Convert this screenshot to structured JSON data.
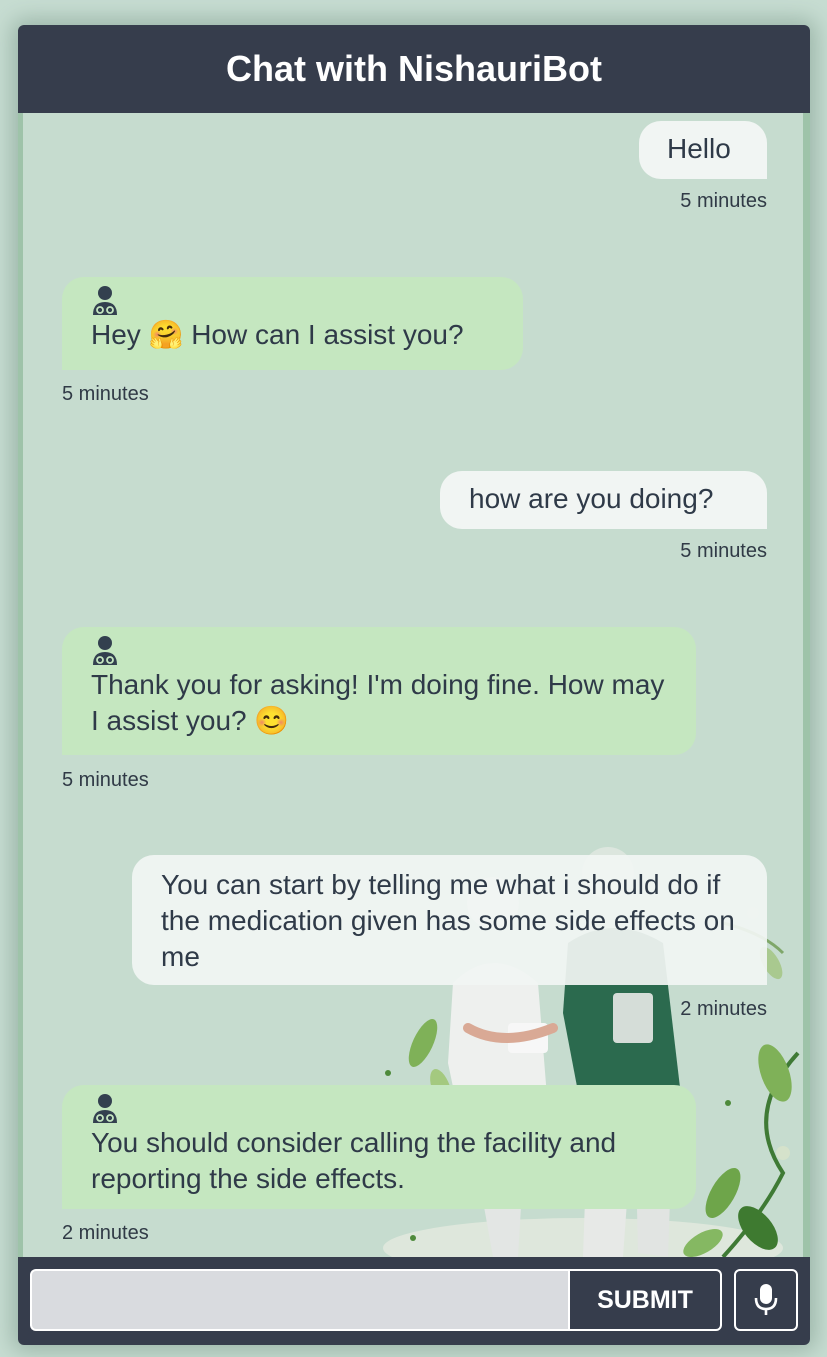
{
  "header": {
    "title": "Chat with NishauriBot"
  },
  "messages": [
    {
      "sender": "user",
      "text": "Hello",
      "time": "5 minutes"
    },
    {
      "sender": "bot",
      "text": "Hey 🤗 How can I assist you?",
      "time": "5 minutes",
      "avatar_icon": "doctor-icon"
    },
    {
      "sender": "user",
      "text": "how are you doing?",
      "time": "5 minutes"
    },
    {
      "sender": "bot",
      "text": "Thank you for asking! I'm doing fine. How may I assist you? 😊",
      "time": "5 minutes",
      "avatar_icon": "doctor-icon"
    },
    {
      "sender": "user",
      "text": "You can start by telling me what i should do if the medication given has some side effects on me",
      "time": "2 minutes"
    },
    {
      "sender": "bot",
      "text": "You should consider calling the facility and reporting the side effects.",
      "time": "2 minutes",
      "avatar_icon": "doctor-icon"
    }
  ],
  "composer": {
    "input_value": "",
    "placeholder": "",
    "submit_label": "SUBMIT",
    "mic_icon": "microphone-icon"
  },
  "colors": {
    "header_bg": "#363d4c",
    "chat_bg": "#c6dccf",
    "user_bubble": "#f1f5f3",
    "bot_bubble": "#c5e7c0",
    "text": "#2f3a48"
  }
}
